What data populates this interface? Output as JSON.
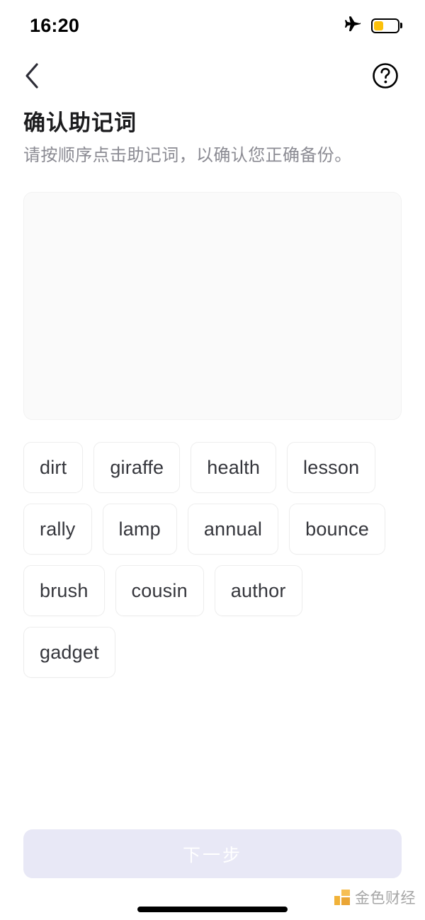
{
  "status_bar": {
    "time": "16:20",
    "airplane_icon": "airplane-mode-icon",
    "battery_icon": "battery-low-icon",
    "battery_level_percent": 35,
    "battery_color": "#fcc10a"
  },
  "nav": {
    "back_icon": "chevron-left-icon",
    "help_icon": "question-circle-icon"
  },
  "header": {
    "title": "确认助记词",
    "subtitle": "请按顺序点击助记词，以确认您正确备份。"
  },
  "drop_zone": {
    "name": "selected-words-area",
    "selected_words": [],
    "background_color": "#fafafa"
  },
  "word_pool": {
    "words": [
      "dirt",
      "giraffe",
      "health",
      "lesson",
      "rally",
      "lamp",
      "annual",
      "bounce",
      "brush",
      "cousin",
      "author",
      "gadget"
    ]
  },
  "footer": {
    "next_label": "下一步",
    "next_enabled": false,
    "next_background_color": "#e8e8f6",
    "next_text_color": "#ffffff"
  },
  "watermark": {
    "text": "金色财经",
    "mark_color": "#f0a81e"
  }
}
